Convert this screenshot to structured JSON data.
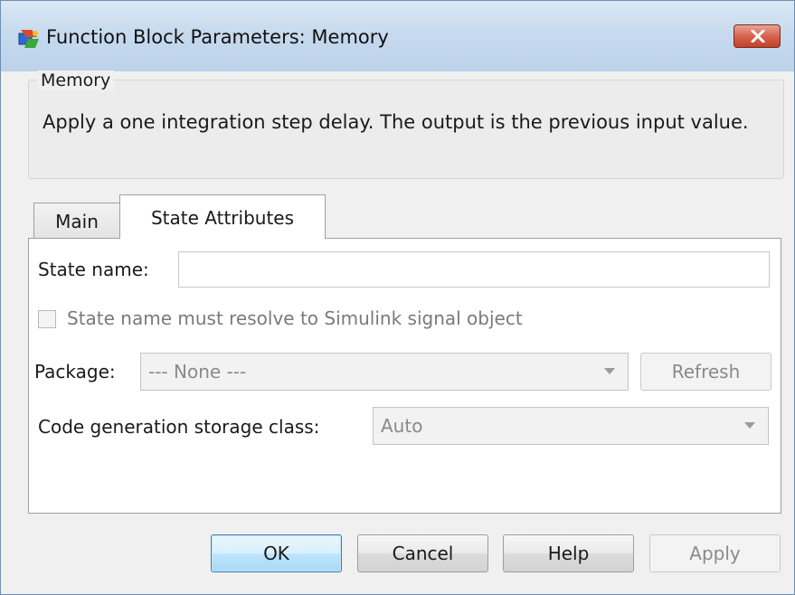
{
  "window": {
    "title": "Function Block Parameters: Memory"
  },
  "group": {
    "legend": "Memory",
    "description": "Apply a one integration step delay. The output is the previous input value."
  },
  "tabs": [
    {
      "label": "Main",
      "active": false
    },
    {
      "label": "State Attributes",
      "active": true
    }
  ],
  "form": {
    "state_name_label": "State name:",
    "state_name_value": "",
    "resolve_checkbox_label": "State name must resolve to Simulink signal object",
    "resolve_checked": false,
    "package_label": "Package:",
    "package_value": "--- None ---",
    "refresh_label": "Refresh",
    "storage_class_label": "Code generation storage class:",
    "storage_class_value": "Auto"
  },
  "buttons": {
    "ok": "OK",
    "cancel": "Cancel",
    "help": "Help",
    "apply": "Apply"
  },
  "colors": {
    "accent_ok": "#3c7fb1",
    "close_button": "#c2412a",
    "disabled_text": "#8a8a8a"
  }
}
